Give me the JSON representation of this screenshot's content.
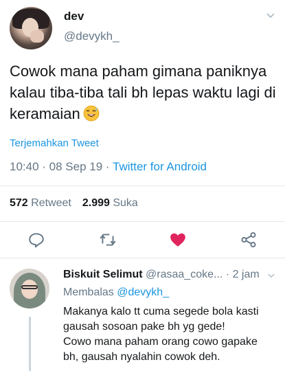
{
  "tweet": {
    "display_name": "dev",
    "handle": "@devykh_",
    "text": "Cowok mana paham gimana paniknya kalau tiba-tiba tali bh lepas waktu lagi di keramaian",
    "emoji": "laughing-sweat-emoji",
    "translate_label": "Terjemahkan Tweet",
    "time": "10:40",
    "date": "08 Sep 19",
    "source": "Twitter for Android",
    "retweet_count": "572",
    "retweet_label": "Retweet",
    "like_count": "2.999",
    "like_label": "Suka",
    "actions": [
      "reply-icon",
      "retweet-icon",
      "like-heart-icon",
      "share-icon"
    ],
    "liked_color": "#e0245e"
  },
  "reply": {
    "display_name": "Biskuit Selimut",
    "handle": "@rasaa_coke...",
    "age": "2 jam",
    "replying_label": "Membalas",
    "replying_to": "@devykh_",
    "lines": [
      "Makanya kalo tt cuma segede bola kasti",
      "gausah sosoan pake bh yg gede!",
      "Cowo mana paham orang cowo gapake",
      "bh, gausah nyalahin cowok deh."
    ]
  },
  "colors": {
    "link_blue": "#1b95e0",
    "secondary_gray": "#657786",
    "divider": "#e1e8ed"
  }
}
